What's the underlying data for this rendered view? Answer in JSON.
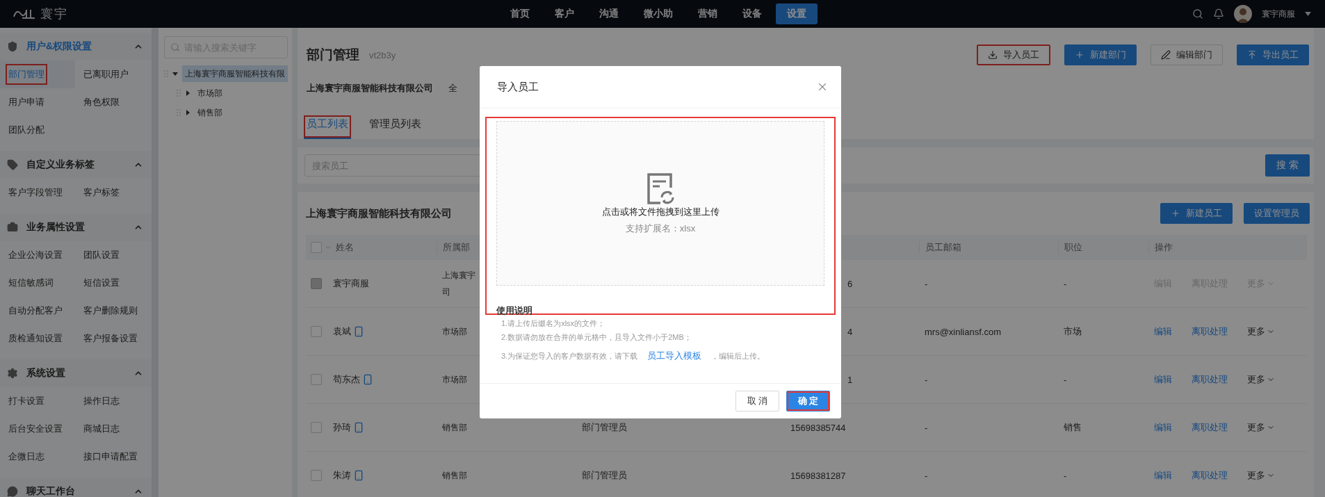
{
  "top_bar": {
    "logo": "寰宇",
    "nav": [
      {
        "label": "首页",
        "selected": false
      },
      {
        "label": "客户",
        "selected": false
      },
      {
        "label": "沟通",
        "selected": false
      },
      {
        "label": "微小助",
        "selected": false
      },
      {
        "label": "营销",
        "selected": false
      },
      {
        "label": "设备",
        "selected": false
      },
      {
        "label": "设置",
        "selected": true
      }
    ],
    "user": "寰宇商服"
  },
  "sidebar": {
    "sections": [
      {
        "title": "用户&权限设置",
        "active": true,
        "expanded": true,
        "items": [
          {
            "label": "部门管理",
            "selected": true,
            "highlighted": true
          },
          {
            "label": "已离职用户",
            "selected": false,
            "highlighted": false
          },
          {
            "label": "用户申请",
            "selected": false,
            "highlighted": false
          },
          {
            "label": "角色权限",
            "selected": false,
            "highlighted": false
          },
          {
            "label": "团队分配",
            "selected": false,
            "highlighted": false
          }
        ]
      },
      {
        "title": "自定义业务标签",
        "active": false,
        "expanded": true,
        "items": [
          {
            "label": "客户字段管理",
            "selected": false,
            "highlighted": false
          },
          {
            "label": "客户标签",
            "selected": false,
            "highlighted": false
          }
        ]
      },
      {
        "title": "业务属性设置",
        "active": false,
        "expanded": true,
        "items": [
          {
            "label": "企业公海设置",
            "selected": false,
            "highlighted": false
          },
          {
            "label": "团队设置",
            "selected": false,
            "highlighted": false
          },
          {
            "label": "短信敏感词",
            "selected": false,
            "highlighted": false
          },
          {
            "label": "短信设置",
            "selected": false,
            "highlighted": false
          },
          {
            "label": "自动分配客户",
            "selected": false,
            "highlighted": false
          },
          {
            "label": "客户删除规则",
            "selected": false,
            "highlighted": false
          },
          {
            "label": "质检通知设置",
            "selected": false,
            "highlighted": false
          },
          {
            "label": "客户报备设置",
            "selected": false,
            "highlighted": false
          }
        ]
      },
      {
        "title": "系统设置",
        "active": false,
        "expanded": true,
        "items": [
          {
            "label": "打卡设置",
            "selected": false,
            "highlighted": false
          },
          {
            "label": "操作日志",
            "selected": false,
            "highlighted": false
          },
          {
            "label": "后台安全设置",
            "selected": false,
            "highlighted": false
          },
          {
            "label": "商城日志",
            "selected": false,
            "highlighted": false
          },
          {
            "label": "企微日志",
            "selected": false,
            "highlighted": false
          },
          {
            "label": "接口申请配置",
            "selected": false,
            "highlighted": false
          }
        ]
      },
      {
        "title": "聊天工作台",
        "active": false,
        "expanded": true
      }
    ]
  },
  "tree": {
    "placeholder": "请输入搜索关键字",
    "nodes": [
      {
        "label": "上海寰宇商服智能科技有限",
        "selected": true,
        "expanded": true,
        "children": [
          {
            "label": "市场部",
            "selected": false,
            "expanded": false
          },
          {
            "label": "销售部",
            "selected": false,
            "expanded": false
          }
        ]
      }
    ]
  },
  "page": {
    "title": "部门管理",
    "code": "vt2b3y",
    "company": "上海寰宇商服智能科技有限公司",
    "scope": "全",
    "actions": [
      {
        "label": "导入员工",
        "primary": false,
        "highlighted": true
      },
      {
        "label": "新建部门",
        "primary": true,
        "highlighted": false
      },
      {
        "label": "编辑部门",
        "primary": false,
        "highlighted": false
      },
      {
        "label": "导出员工",
        "primary": true,
        "highlighted": false
      }
    ]
  },
  "tabs": [
    {
      "label": "员工列表",
      "selected": true,
      "highlighted": true
    },
    {
      "label": "管理员列表",
      "selected": false,
      "highlighted": false
    }
  ],
  "search": {
    "placeholder": "搜索员工",
    "button": "搜 索"
  },
  "table": {
    "title": "上海寰宇商服智能科技有限公司",
    "actions": [
      "新建员工",
      "设置管理员"
    ],
    "all_checked": false,
    "columns": [
      "姓名",
      "所属部",
      "员工邮箱",
      "职位",
      "操作"
    ],
    "rows": [
      {
        "name": "寰宇商服",
        "mobile": false,
        "checked": false,
        "checkbox_disabled": true,
        "department": [
          "上海寰宇",
          "司"
        ],
        "phone": "6",
        "email": "-",
        "position": "-",
        "actions": [
          {
            "label": "编辑",
            "kind": "link",
            "disabled": true
          },
          {
            "label": "离职处理",
            "kind": "link",
            "disabled": true
          },
          {
            "label": "更多",
            "kind": "more",
            "disabled": true
          }
        ]
      },
      {
        "name": "袁斌",
        "mobile": true,
        "checked": false,
        "checkbox_disabled": false,
        "department": [
          "市场部"
        ],
        "phone": "4",
        "email": "mrs@xinliansf.com",
        "position": "市场",
        "actions": [
          {
            "label": "编辑",
            "kind": "link",
            "disabled": false
          },
          {
            "label": "离职处理",
            "kind": "link",
            "disabled": false
          },
          {
            "label": "更多",
            "kind": "more",
            "disabled": false
          }
        ]
      },
      {
        "name": "苟东杰",
        "mobile": true,
        "checked": false,
        "checkbox_disabled": false,
        "department": [
          "市场部"
        ],
        "phone": "1",
        "email": "-",
        "position": "-",
        "actions": [
          {
            "label": "编辑",
            "kind": "link",
            "disabled": false
          },
          {
            "label": "离职处理",
            "kind": "link",
            "disabled": false
          },
          {
            "label": "更多",
            "kind": "more",
            "disabled": false
          }
        ]
      },
      {
        "name": "孙琦",
        "mobile": true,
        "checked": false,
        "checkbox_disabled": false,
        "department": [
          "销售部"
        ],
        "role": "部门管理员",
        "phone": "15698385744",
        "email": "-",
        "position": "销售",
        "actions": [
          {
            "label": "编辑",
            "kind": "link",
            "disabled": false
          },
          {
            "label": "离职处理",
            "kind": "link",
            "disabled": false
          },
          {
            "label": "更多",
            "kind": "more",
            "disabled": false
          }
        ]
      },
      {
        "name": "朱涛",
        "mobile": true,
        "checked": false,
        "checkbox_disabled": false,
        "department": [
          "销售部"
        ],
        "role": "部门管理员",
        "phone": "15698381287",
        "email": "-",
        "position": "-",
        "actions": [
          {
            "label": "编辑",
            "kind": "link",
            "disabled": false
          },
          {
            "label": "离职处理",
            "kind": "link",
            "disabled": false
          },
          {
            "label": "更多",
            "kind": "more",
            "disabled": false
          }
        ]
      }
    ]
  },
  "dialog": {
    "title": "导入员工",
    "upload": {
      "highlighted": true,
      "text": "点击或将文件拖拽到这里上传",
      "hint": "支持扩展名：xlsx"
    },
    "instructions": {
      "title": "使用说明",
      "lines": [
        "1.请上传后缀名为xlsx的文件；",
        "2.数据请勿放在合并的单元格中，且导入文件小于2MB；"
      ],
      "last": {
        "before": "3.为保证您导入的客户数据有效，请下载",
        "link": "员工导入模板",
        "after": "，编辑后上传。"
      }
    },
    "buttons": [
      {
        "label": "取 消",
        "primary": false,
        "highlighted": false
      },
      {
        "label": "确 定",
        "primary": true,
        "highlighted": true
      }
    ]
  }
}
